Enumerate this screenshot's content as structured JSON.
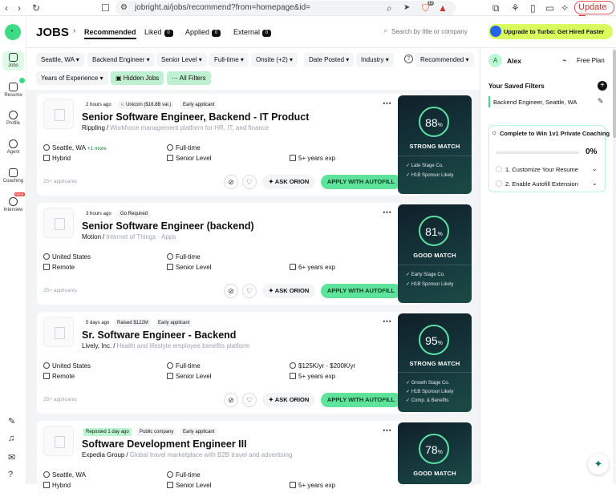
{
  "browser": {
    "url": "jobright.ai/jobs/recommend?from=homepage&id=",
    "update_label": "Update",
    "extension_badge": "10"
  },
  "sidebar": {
    "items": [
      {
        "label": "Jobs",
        "icon": "briefcase-icon"
      },
      {
        "label": "Resume",
        "icon": "resume-icon"
      },
      {
        "label": "Profile",
        "icon": "user-icon"
      },
      {
        "label": "Agent",
        "icon": "agent-icon"
      },
      {
        "label": "Coaching",
        "icon": "coaching-icon"
      },
      {
        "label": "Interview",
        "icon": "interview-icon",
        "badge": "NEW"
      }
    ]
  },
  "header": {
    "title": "JOBS",
    "tabs": [
      {
        "label": "Recommended",
        "active": true
      },
      {
        "label": "Liked",
        "count": "0"
      },
      {
        "label": "Applied",
        "count": "0"
      },
      {
        "label": "External",
        "count": "0"
      }
    ],
    "search_placeholder": "Search by title or company",
    "upgrade_label": "Upgrade to Turbo: Get Hired Faster"
  },
  "filters": {
    "chips": [
      "Seattle, WA",
      "Backend Engineer",
      "Senior Level",
      "Full-time",
      "Onsite (+2)",
      "Date Posted",
      "Industry"
    ],
    "sort": "Recommended",
    "experience": "Years of Experience",
    "hidden_jobs": "Hidden Jobs",
    "all_filters": "All Filters"
  },
  "jobs": [
    {
      "age": "2 hours ago",
      "tags": [
        "Unicorn ($16.8B val.)",
        "Early applicant"
      ],
      "title": "Senior Software Engineer, Backend - IT Product",
      "company": "Rippling",
      "description": "Workforce management platform for HR, IT, and finance",
      "location": "Seattle, WA",
      "location_more": "+1 more",
      "work_mode": "Hybrid",
      "type": "Full-time",
      "level": "Senior Level",
      "experience": "5+ years exp",
      "salary": "",
      "applicants": "25+ applicants",
      "match_percent": "88",
      "match_label": "STRONG MATCH",
      "match_points": [
        "Late Stage Co.",
        "H1B Sponsor Likely"
      ]
    },
    {
      "age": "3 hours ago",
      "tags": [
        "Go Required"
      ],
      "title": "Senior Software Engineer (backend)",
      "company": "Motion",
      "description": "Internet of Things · Apps",
      "location": "United States",
      "location_more": "",
      "work_mode": "Remote",
      "type": "Full-time",
      "level": "Senior Level",
      "experience": "6+ years exp",
      "salary": "",
      "applicants": "25+ applicants",
      "match_percent": "81",
      "match_label": "GOOD MATCH",
      "match_points": [
        "Early Stage Co.",
        "H1B Sponsor Likely"
      ]
    },
    {
      "age": "5 days ago",
      "tags": [
        "Raised $122M",
        "Early applicant"
      ],
      "title": "Sr. Software Engineer - Backend",
      "company": "Lively, Inc.",
      "description": "Health and lifestyle employee benefits platform",
      "location": "United States",
      "location_more": "",
      "work_mode": "Remote",
      "type": "Full-time",
      "level": "Senior Level",
      "experience": "5+ years exp",
      "salary": "$125K/yr - $200K/yr",
      "applicants": "25+ applicants",
      "match_percent": "95",
      "match_label": "STRONG MATCH",
      "match_points": [
        "Growth Stage Co.",
        "H1B Sponsor Likely",
        "Comp. & Benefits"
      ]
    },
    {
      "age": "Reposted 1 day ago",
      "tags": [
        "Public company",
        "Early applicant"
      ],
      "title": "Software Development Engineer III",
      "company": "Expedia Group",
      "description": "Global travel marketplace with B2B travel and advertising",
      "location": "Seattle, WA",
      "location_more": "",
      "work_mode": "Hybrid",
      "type": "Full-time",
      "level": "Senior Level",
      "experience": "5+ years exp",
      "salary": "",
      "applicants": "",
      "match_percent": "78",
      "match_label": "GOOD MATCH",
      "match_points": []
    }
  ],
  "actions": {
    "ask_orion": "ASK ORION",
    "apply": "APPLY WITH AUTOFILL"
  },
  "right_panel": {
    "user_initial": "A",
    "user_name": "Alex",
    "plan": "Free Plan",
    "saved_filters_title": "Your Saved Filters",
    "saved_filter": "Backend Engineer, Seattle, WA",
    "coaching_title": "Complete to Win 1v1 Private Coaching",
    "progress_percent": "0%",
    "progress_value": 0,
    "steps": [
      "1. Customize Your Resume",
      "2. Enable Autofill Extension"
    ]
  },
  "colors": {
    "accent": "#5ee39a",
    "match_bg": "#163a3e",
    "upgrade_bg": "#d8fb5d"
  }
}
